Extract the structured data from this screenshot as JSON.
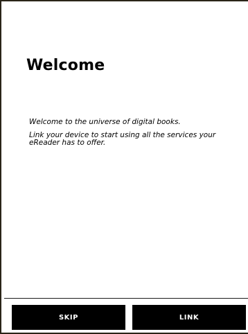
{
  "screen": {
    "title": "Welcome",
    "paragraphs": [
      "Welcome to the universe of digital books.",
      "Link your device to start using all the services your eReader has to offer."
    ]
  },
  "actions": {
    "skip_label": "SKIP",
    "link_label": "LINK"
  },
  "colors": {
    "background": "#ffffff",
    "button_background": "#000000",
    "button_text": "#ffffff",
    "frame_border": "#2a2418"
  }
}
